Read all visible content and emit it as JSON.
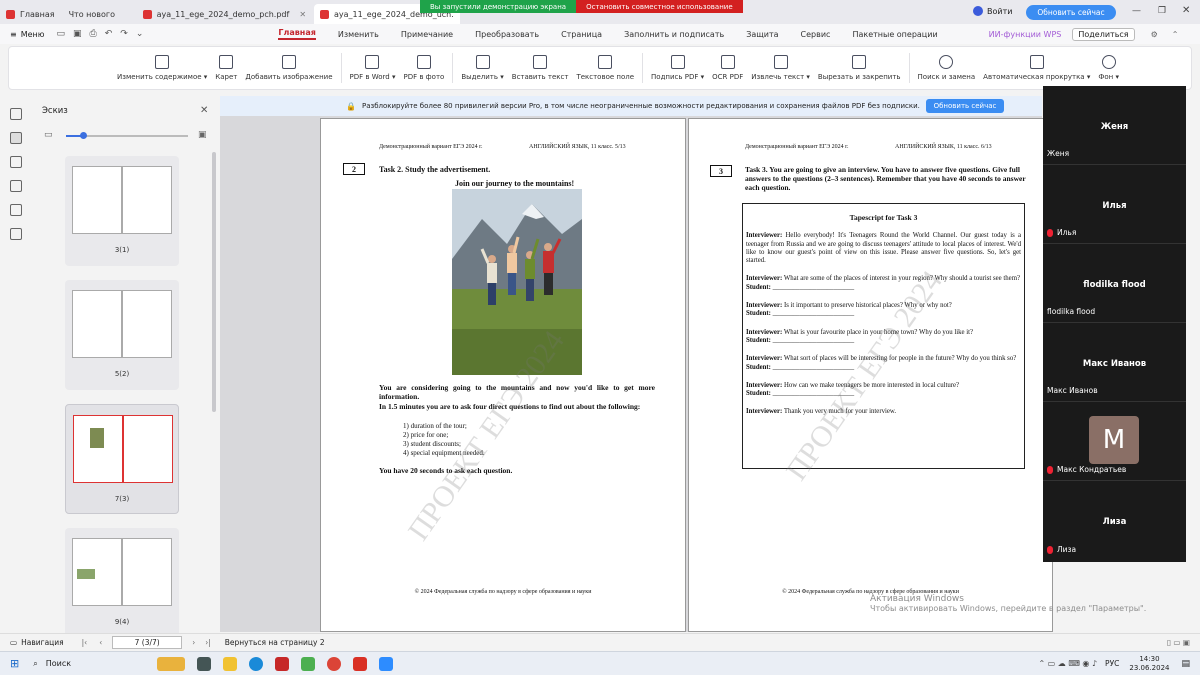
{
  "tabs": [
    {
      "label": "Главная",
      "color": "#d33"
    },
    {
      "label": "Что нового",
      "color": "#888"
    },
    {
      "label": "aya_11_ege_2024_demo_pch.pdf",
      "color": "#d33"
    },
    {
      "label": "aya_11_ege_2024_demo_uch.",
      "color": "#d33"
    }
  ],
  "share": {
    "status": "Вы запустили демонстрацию экрана",
    "stop": "Остановить совместное использование"
  },
  "titlebar": {
    "login": "Войти",
    "update": "Обновить сейчас"
  },
  "menubar": {
    "menu_label": "Меню",
    "items": [
      "Главная",
      "Изменить",
      "Примечание",
      "Преобразовать",
      "Страница",
      "Заполнить и подписать",
      "Защита",
      "Сервис",
      "Пакетные операции"
    ],
    "ai": "ИИ-функции WPS",
    "share_btn": "Поделиться"
  },
  "ribbon": [
    "Изменить содержимое ▾",
    "Карет",
    "Добавить изображение",
    "PDF в Word ▾",
    "PDF в фото",
    "Выделить ▾",
    "Вставить текст",
    "Текстовое поле",
    "Подпись PDF ▾",
    "OCR PDF",
    "Извлечь текст ▾",
    "Вырезать и закрепить",
    "Поиск и замена",
    "Автоматическая прокрутка ▾",
    "Фон ▾"
  ],
  "sidebar": {
    "title": "Эскиз",
    "thumbs": [
      "3(1)",
      "5(2)",
      "7(3)",
      "9(4)"
    ],
    "selected": 2
  },
  "probar": {
    "text": "Разблокируйте более 80 привилегий версии Pro, в том числе неограниченные возможности редактирования и сохранения файлов PDF без подписки.",
    "button": "Обновить сейчас"
  },
  "page_left": {
    "header_left": "Демонстрационный вариант ЕГЭ 2024 г.",
    "header_right": "АНГЛИЙСКИЙ ЯЗЫК, 11 класс. 5/13",
    "task_num": "2",
    "task_title": "Task 2. Study the advertisement.",
    "ad_title": "Join our journey to the mountains!",
    "body1": "You are considering going to the mountains and now you'd like to get more information.",
    "body2": "In 1.5 minutes you are to ask four direct questions to find out about the following:",
    "items": [
      "1) duration of the tour;",
      "2) price for one;",
      "3) student discounts;",
      "4) special equipment needed."
    ],
    "body3": "You have 20 seconds to ask each question.",
    "footer": "© 2024 Федеральная служба по надзору в сфере образования и науки",
    "watermark": "ПРОЕКТ ЕГЭ 2024"
  },
  "page_right": {
    "header_left": "Демонстрационный вариант ЕГЭ 2024 г.",
    "header_right": "АНГЛИЙСКИЙ ЯЗЫК, 11 класс. 6/13",
    "task_num": "3",
    "task_title": "Task 3. You are going to give an interview. You have to answer five questions. Give full answers to the questions (2–3 sentences). Remember that you have 40 seconds to answer each question.",
    "box_title": "Tapescript for Task 3",
    "intro_label": "Interviewer:",
    "intro": "Hello everybody! It's Teenagers Round the World Channel. Our guest today is a teenager from Russia and we are going to discuss teenagers' attitude to local places of interest. We'd like to know our guest's point of view on this issue. Please answer five questions. So, let's get started.",
    "questions": [
      "What are some of the places of interest in your region? Why should a tourist see them?",
      "Is it important to preserve historical places? Why or why not?",
      "What is your favourite place in your home town? Why do you like it?",
      "What sort of places will be interesting for people in the future? Why do you think so?",
      "How can we make teenagers be more interested in local culture?"
    ],
    "student_label": "Student:",
    "blank": "________________________",
    "closing": "Thank you very much for your interview.",
    "footer": "© 2024 Федеральная служба по надзору в сфере образования и науки",
    "watermark": "ПРОЕКТ ЕГЭ 2024"
  },
  "participants": [
    {
      "name": "Женя",
      "tag": "Женя",
      "muted": false
    },
    {
      "name": "Илья",
      "tag": "Илья",
      "muted": true
    },
    {
      "name": "flodilka flood",
      "tag": "flodilka flood",
      "muted": false
    },
    {
      "name": "Макс Иванов",
      "tag": "Макс Иванов",
      "muted": false
    },
    {
      "name": "",
      "tag": "Макс Кондратьев",
      "muted": true,
      "avatar": "M"
    },
    {
      "name": "Лиза",
      "tag": "Лиза",
      "muted": true
    }
  ],
  "status": {
    "nav": "Навигация",
    "page": "7 (3/7)",
    "back": "Вернуться на страницу 2"
  },
  "windows": {
    "line1": "Активация Windows",
    "line2": "Чтобы активировать Windows, перейдите в раздел \"Параметры\"."
  },
  "taskbar": {
    "search": "Поиск",
    "lang": "РУС",
    "time": "14:30",
    "date": "23.06.2024"
  }
}
